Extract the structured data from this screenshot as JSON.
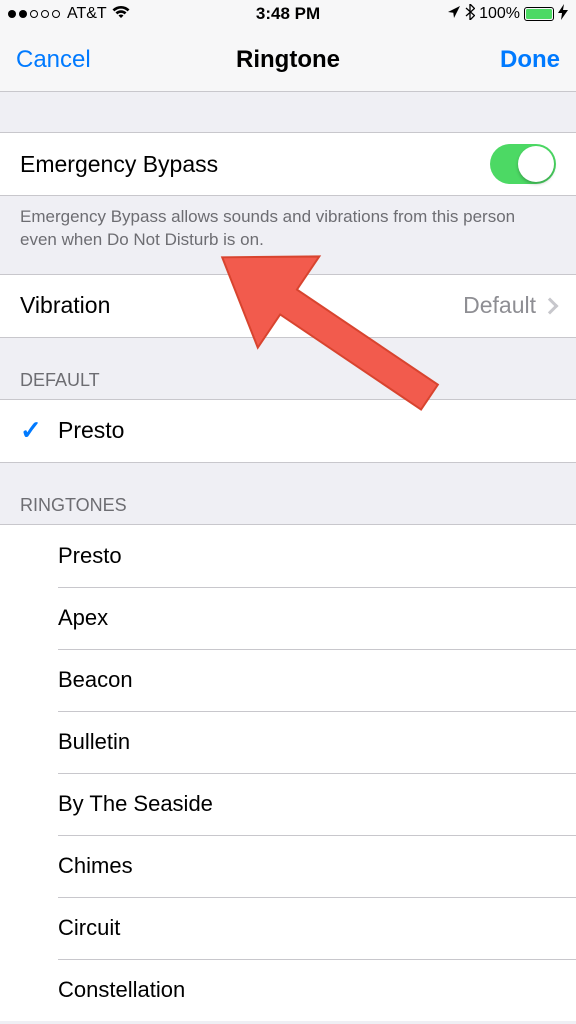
{
  "statusbar": {
    "carrier": "AT&T",
    "time": "3:48 PM",
    "battery": "100%"
  },
  "navbar": {
    "left": "Cancel",
    "title": "Ringtone",
    "right": "Done"
  },
  "emergency_bypass": {
    "label": "Emergency Bypass",
    "footer": "Emergency Bypass allows sounds and vibrations from this person even when Do Not Disturb is on."
  },
  "vibration": {
    "label": "Vibration",
    "value": "Default"
  },
  "default_section": {
    "header": "DEFAULT",
    "item": "Presto"
  },
  "ringtones_section": {
    "header": "RINGTONES",
    "items": [
      "Presto",
      "Apex",
      "Beacon",
      "Bulletin",
      "By The Seaside",
      "Chimes",
      "Circuit",
      "Constellation"
    ]
  }
}
